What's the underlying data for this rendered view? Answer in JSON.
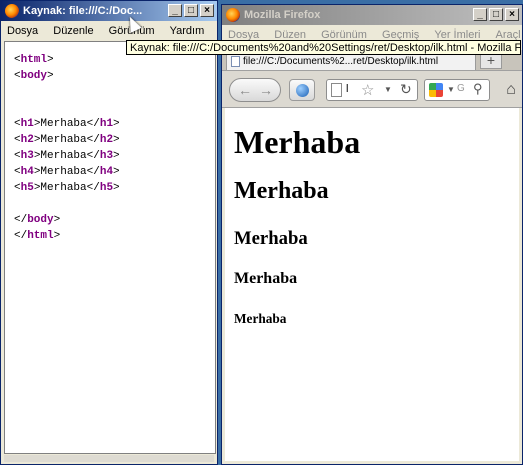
{
  "source_window": {
    "title": "Kaynak: file:///C:/Doc...",
    "menu": [
      "Dosya",
      "Düzenle",
      "Görünüm",
      "Yardım"
    ],
    "code_lines": [
      {
        "open": "<",
        "tag": "html",
        "close": ">",
        "text": ""
      },
      {
        "open": "<",
        "tag": "body",
        "close": ">",
        "text": ""
      },
      {
        "open": "",
        "tag": "",
        "close": "",
        "text": ""
      },
      {
        "open": "",
        "tag": "",
        "close": "",
        "text": ""
      },
      {
        "open": "<",
        "tag": "h1",
        "close": ">",
        "text": "Merhaba",
        "end_open": "</",
        "end_tag": "h1",
        "end_close": ">"
      },
      {
        "open": "<",
        "tag": "h2",
        "close": ">",
        "text": "Merhaba",
        "end_open": "</",
        "end_tag": "h2",
        "end_close": ">"
      },
      {
        "open": "<",
        "tag": "h3",
        "close": ">",
        "text": "Merhaba",
        "end_open": "</",
        "end_tag": "h3",
        "end_close": ">"
      },
      {
        "open": "<",
        "tag": "h4",
        "close": ">",
        "text": "Merhaba",
        "end_open": "</",
        "end_tag": "h4",
        "end_close": ">"
      },
      {
        "open": "<",
        "tag": "h5",
        "close": ">",
        "text": "Merhaba",
        "end_open": "</",
        "end_tag": "h5",
        "end_close": ">"
      },
      {
        "open": "",
        "tag": "",
        "close": "",
        "text": ""
      },
      {
        "open": "</",
        "tag": "body",
        "close": ">",
        "text": ""
      },
      {
        "open": "</",
        "tag": "html",
        "close": ">",
        "text": ""
      }
    ]
  },
  "tooltip": "Kaynak: file:///C:/Documents%20and%20Settings/ret/Desktop/ilk.html - Mozilla Firefox",
  "firefox_window": {
    "title": "Mozilla Firefox",
    "menu": [
      "Dosya",
      "Düzen",
      "Görünüm",
      "Geçmiş",
      "Yer İmleri",
      "Araçl"
    ],
    "tab_label": "file:///C:/Documents%2...ret/Desktop/ilk.html",
    "newtab_label": "+",
    "url_text": "l",
    "search_text": "G",
    "content": {
      "h1": "Merhaba",
      "h2": "Merhaba",
      "h3": "Merhaba",
      "h4": "Merhaba",
      "h5": "Merhaba"
    }
  },
  "colors": {
    "titlebar_active": "#0a246a",
    "code_tag": "#800080",
    "tooltip_bg": "#ffffe1"
  }
}
